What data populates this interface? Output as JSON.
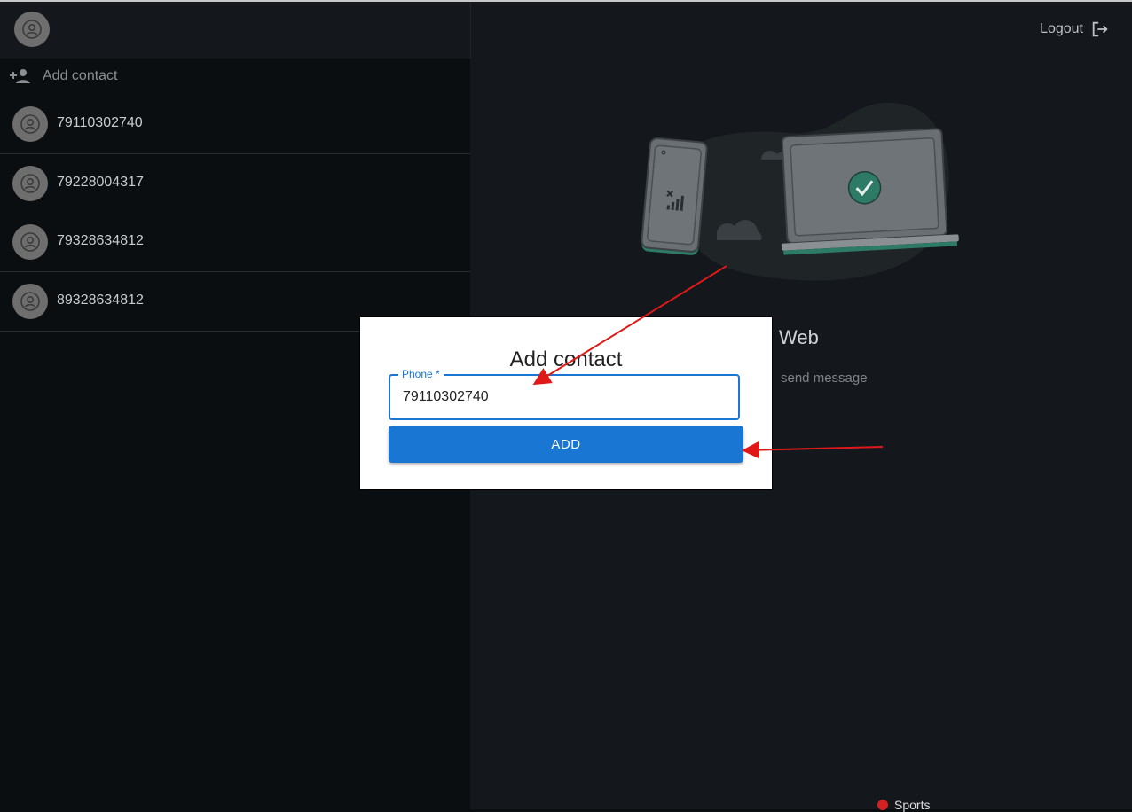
{
  "sidebar": {
    "add_contact_label": "Add contact",
    "contacts": [
      {
        "phone": "79110302740"
      },
      {
        "phone": "79228004317"
      },
      {
        "phone": "79328634812"
      },
      {
        "phone": "89328634812"
      }
    ]
  },
  "header": {
    "logout_label": "Logout"
  },
  "main": {
    "title_fragment": "Web",
    "subtitle_fragment": "send message",
    "bottom_fragment": "Sports"
  },
  "modal": {
    "title": "Add contact",
    "phone_label": "Phone *",
    "phone_value": "79110302740",
    "add_button_label": "ADD"
  },
  "colors": {
    "accent": "#1976d2",
    "arrow": "#e01818",
    "background": "#0b0e10",
    "panel": "#14181c"
  },
  "icons": {
    "add_contact": "person-add-icon",
    "logout": "logout-icon",
    "avatar": "avatar-icon"
  }
}
